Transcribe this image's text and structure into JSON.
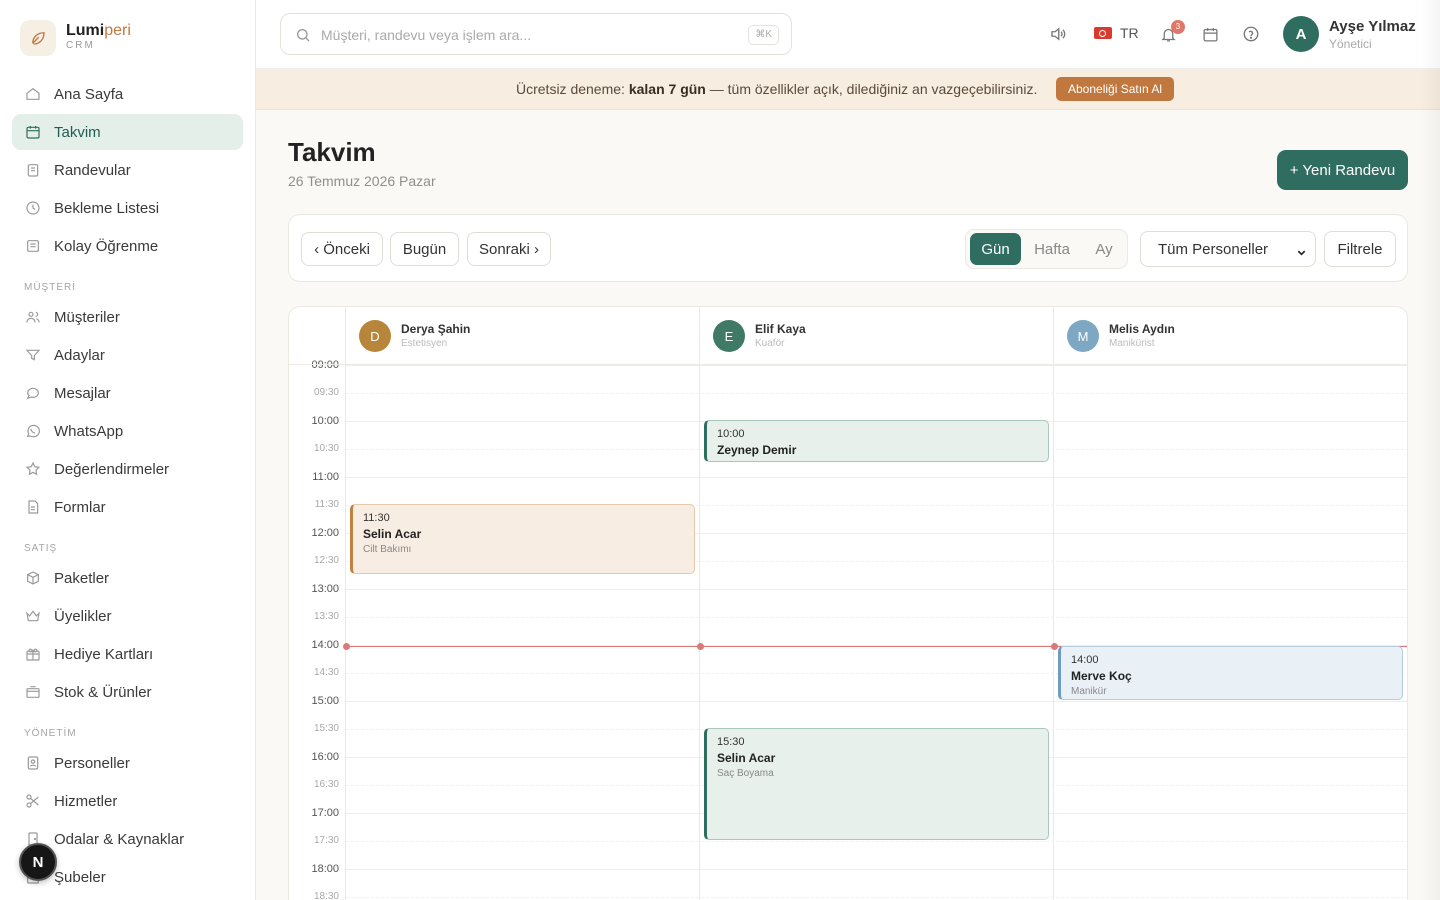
{
  "brand": {
    "name_main": "Lumi",
    "name_accent": "peri",
    "sub": "CRM"
  },
  "sidebar": {
    "items": [
      {
        "label": "Ana Sayfa",
        "icon": "home-icon"
      },
      {
        "label": "Takvim",
        "icon": "calendar-icon",
        "active": true
      },
      {
        "label": "Randevular",
        "icon": "clipboard-icon"
      },
      {
        "label": "Bekleme Listesi",
        "icon": "clock-icon"
      },
      {
        "label": "Kolay Öğrenme",
        "icon": "book-icon"
      }
    ],
    "section_customer": "MÜŞTERİ",
    "customer_items": [
      {
        "label": "Müşteriler",
        "icon": "users-icon"
      },
      {
        "label": "Adaylar",
        "icon": "filter-icon"
      },
      {
        "label": "Mesajlar",
        "icon": "message-icon"
      },
      {
        "label": "WhatsApp",
        "icon": "whatsapp-icon"
      },
      {
        "label": "Değerlendirmeler",
        "icon": "star-icon"
      },
      {
        "label": "Formlar",
        "icon": "form-icon"
      }
    ],
    "section_sales": "SATIŞ",
    "sales_items": [
      {
        "label": "Paketler",
        "icon": "box-icon"
      },
      {
        "label": "Üyelikler",
        "icon": "crown-icon"
      },
      {
        "label": "Hediye Kartları",
        "icon": "gift-icon"
      },
      {
        "label": "Stok & Ürünler",
        "icon": "inventory-icon"
      }
    ],
    "section_admin": "YÖNETİM",
    "admin_items": [
      {
        "label": "Personeller",
        "icon": "badge-icon"
      },
      {
        "label": "Hizmetler",
        "icon": "scissors-icon"
      },
      {
        "label": "Odalar & Kaynaklar",
        "icon": "door-icon"
      },
      {
        "label": "Şubeler",
        "icon": "building-icon"
      }
    ],
    "floating_badge": "N"
  },
  "topbar": {
    "search_placeholder": "Müşteri, randevu veya işlem ara...",
    "shortcut": "⌘K",
    "language": "TR",
    "notification_count": "3",
    "user": {
      "initial": "A",
      "name": "Ayşe Yılmaz",
      "role": "Yönetici"
    }
  },
  "trial": {
    "prefix": "Ücretsiz deneme: ",
    "bold": "kalan 7 gün",
    "suffix": " — tüm özellikler açık, dilediğiniz an vazgeçebilirsiniz.",
    "button": "Aboneliği Satın Al"
  },
  "page": {
    "title": "Takvim",
    "date": "26 Temmuz 2026 Pazar",
    "new_button": "+ Yeni Randevu"
  },
  "toolbar": {
    "prev": "‹ Önceki",
    "today": "Bugün",
    "next": "Sonraki ›",
    "views": [
      "Gün",
      "Hafta",
      "Ay"
    ],
    "active_view": "Gün",
    "staff_filter": "Tüm Personeller",
    "filter_button": "Filtrele"
  },
  "staff": [
    {
      "initial": "D",
      "name": "Derya Şahin",
      "role": "Estetisyen",
      "color": "#b8863b"
    },
    {
      "initial": "E",
      "name": "Elif Kaya",
      "role": "Kuaför",
      "color": "#3e7a66"
    },
    {
      "initial": "M",
      "name": "Melis Aydın",
      "role": "Manikürist",
      "color": "#7ea7c4"
    }
  ],
  "times": [
    "09:00",
    "09:30",
    "10:00",
    "10:30",
    "11:00",
    "11:30",
    "12:00",
    "12:30",
    "13:00",
    "13:30",
    "14:00",
    "14:30",
    "15:00",
    "15:30",
    "16:00",
    "16:30",
    "17:00",
    "17:30",
    "18:00",
    "18:30"
  ],
  "appointments": [
    {
      "time": "10:00",
      "name": "Zeynep Demir",
      "service": "",
      "staff": 1,
      "color": "green"
    },
    {
      "time": "11:30",
      "name": "Selin Acar",
      "service": "Cilt Bakımı",
      "staff": 0,
      "color": "beige"
    },
    {
      "time": "14:00",
      "name": "Merve Koç",
      "service": "Manikür",
      "staff": 2,
      "color": "blue"
    },
    {
      "time": "15:30",
      "name": "Selin Acar",
      "service": "Saç Boyama",
      "staff": 1,
      "color": "green"
    }
  ]
}
